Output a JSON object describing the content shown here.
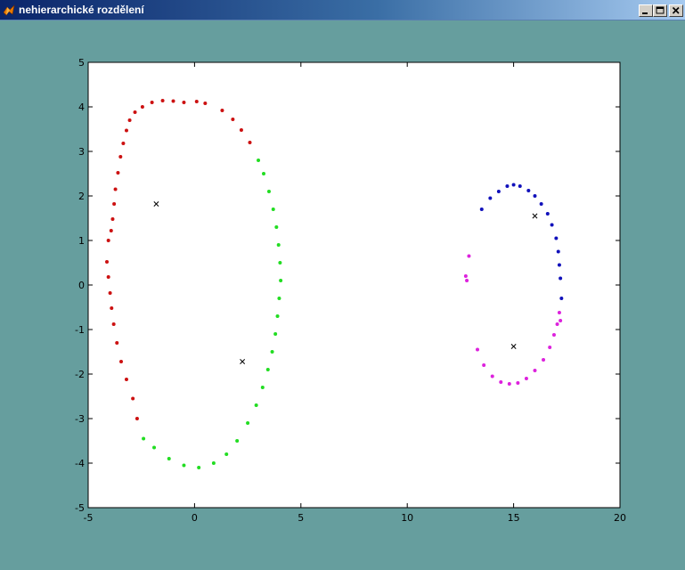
{
  "window": {
    "title": "nehierarchické rozdělení",
    "icon": "matlab-icon",
    "controls": [
      "minimize",
      "maximize",
      "close"
    ]
  },
  "colors": {
    "figure_background": "#669e9e",
    "axes_background": "#ffffff",
    "axes_edge": "#000000",
    "centroid_marker": "#000000"
  },
  "chart_data": {
    "type": "scatter",
    "xlim": [
      -5,
      20
    ],
    "ylim": [
      -5,
      5
    ],
    "xticks": [
      "-5",
      "0",
      "5",
      "10",
      "15",
      "20"
    ],
    "yticks": [
      "-5",
      "-4",
      "-3",
      "-2",
      "-1",
      "0",
      "1",
      "2",
      "3",
      "4",
      "5"
    ],
    "grid": false,
    "series": [
      {
        "color": "#cc1111",
        "marker": "dot",
        "x": [
          -4.05,
          -3.92,
          -3.85,
          -3.78,
          -3.72,
          -3.6,
          -3.48,
          -3.35,
          -3.2,
          -3.05,
          -2.8,
          -2.45,
          -2.0,
          -1.5,
          -1.0,
          -0.5,
          0.1,
          0.5,
          1.3,
          1.8,
          2.2,
          2.6,
          -4.12,
          -4.05,
          -3.97,
          -3.9,
          -3.8,
          -3.65,
          -3.45,
          -3.2,
          -2.9,
          -2.7
        ],
        "y": [
          1.0,
          1.22,
          1.48,
          1.82,
          2.15,
          2.52,
          2.88,
          3.18,
          3.47,
          3.7,
          3.88,
          4.0,
          4.1,
          4.14,
          4.13,
          4.1,
          4.12,
          4.08,
          3.92,
          3.72,
          3.48,
          3.2,
          0.52,
          0.18,
          -0.18,
          -0.52,
          -0.88,
          -1.3,
          -1.72,
          -2.12,
          -2.55,
          -3.0
        ]
      },
      {
        "color": "#22dd22",
        "marker": "dot",
        "x": [
          3.0,
          3.25,
          3.5,
          3.7,
          3.85,
          3.95,
          4.02,
          4.05,
          3.98,
          3.9,
          3.8,
          3.65,
          3.45,
          3.2,
          2.9,
          2.5,
          2.0,
          1.5,
          0.9,
          0.2,
          -0.5,
          -1.2,
          -1.9,
          -2.4
        ],
        "y": [
          2.8,
          2.5,
          2.1,
          1.7,
          1.3,
          0.9,
          0.5,
          0.1,
          -0.3,
          -0.7,
          -1.1,
          -1.5,
          -1.9,
          -2.3,
          -2.7,
          -3.1,
          -3.5,
          -3.8,
          -4.0,
          -4.1,
          -4.05,
          -3.9,
          -3.65,
          -3.45
        ]
      },
      {
        "color": "#1111bb",
        "marker": "dot",
        "x": [
          13.5,
          13.9,
          14.3,
          14.7,
          15.0,
          15.3,
          15.7,
          16.0,
          16.3,
          16.6,
          16.8,
          17.0,
          17.1,
          17.15,
          17.2,
          17.25
        ],
        "y": [
          1.7,
          1.95,
          2.1,
          2.22,
          2.25,
          2.22,
          2.12,
          2.0,
          1.82,
          1.6,
          1.35,
          1.05,
          0.75,
          0.45,
          0.15,
          -0.3
        ]
      },
      {
        "color": "#dd22dd",
        "marker": "dot",
        "x": [
          12.75,
          12.8,
          12.9,
          13.3,
          13.6,
          14.0,
          14.4,
          14.8,
          15.2,
          15.6,
          16.0,
          16.4,
          16.7,
          16.9,
          17.05,
          17.15,
          17.2
        ],
        "y": [
          0.2,
          0.1,
          0.65,
          -1.45,
          -1.8,
          -2.05,
          -2.18,
          -2.22,
          -2.2,
          -2.1,
          -1.92,
          -1.68,
          -1.4,
          -1.12,
          -0.88,
          -0.62,
          -0.8
        ]
      },
      {
        "color": "#000000",
        "marker": "x",
        "x": [
          -1.8,
          2.25,
          16.0,
          15.0
        ],
        "y": [
          1.82,
          -1.72,
          1.55,
          -1.38
        ]
      }
    ]
  }
}
